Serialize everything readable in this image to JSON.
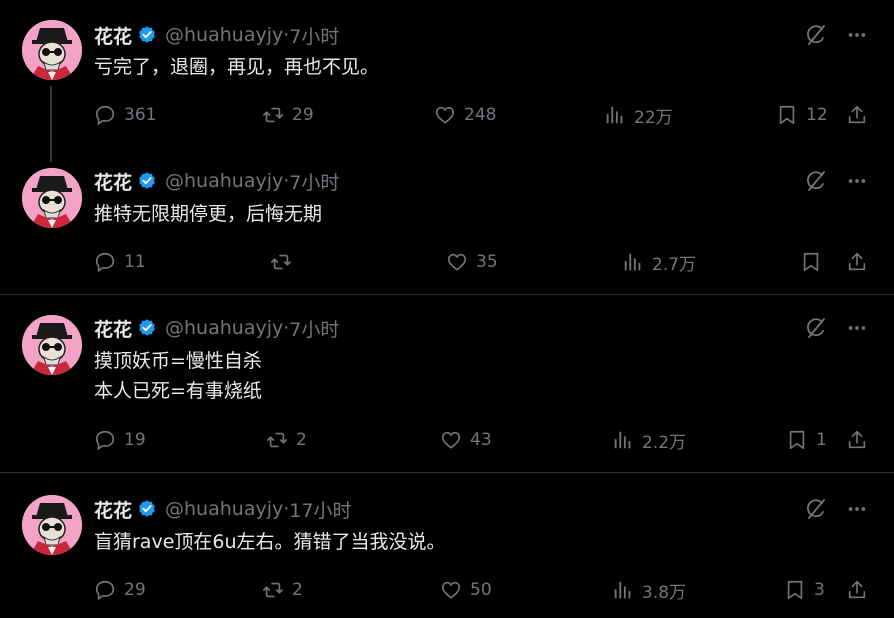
{
  "tweets": [
    {
      "name": "花花",
      "handle": "@huahuayjy",
      "time": "7小时",
      "text": "亏完了，退圈，再见，再也不见。",
      "replies": "361",
      "retweets": "29",
      "likes": "248",
      "views": "22万",
      "bookmarks": "12"
    },
    {
      "name": "花花",
      "handle": "@huahuayjy",
      "time": "7小时",
      "text": "推特无限期停更，后悔无期",
      "replies": "11",
      "retweets": "",
      "likes": "35",
      "views": "2.7万",
      "bookmarks": ""
    },
    {
      "name": "花花",
      "handle": "@huahuayjy",
      "time": "7小时",
      "text": "摸顶妖币=慢性自杀\n本人已死=有事烧纸",
      "replies": "19",
      "retweets": "2",
      "likes": "43",
      "views": "2.2万",
      "bookmarks": "1"
    },
    {
      "name": "花花",
      "handle": "@huahuayjy",
      "time": "17小时",
      "text": "盲猜rave顶在6u左右。猜错了当我没说。",
      "replies": "29",
      "retweets": "2",
      "likes": "50",
      "views": "3.8万",
      "bookmarks": "3"
    }
  ],
  "separator": " · ",
  "icons": {
    "reply": "reply-icon",
    "retweet": "retweet-icon",
    "like": "heart-icon",
    "views": "views-icon",
    "bookmark": "bookmark-icon",
    "share": "share-icon",
    "grok": "grok-icon",
    "more": "more-icon",
    "verified": "verified-badge-icon"
  },
  "colors": {
    "background": "#000000",
    "text": "#e7e9ea",
    "muted": "#71767b",
    "verified": "#1d9bf0",
    "avatar": "#f3a3c6"
  }
}
